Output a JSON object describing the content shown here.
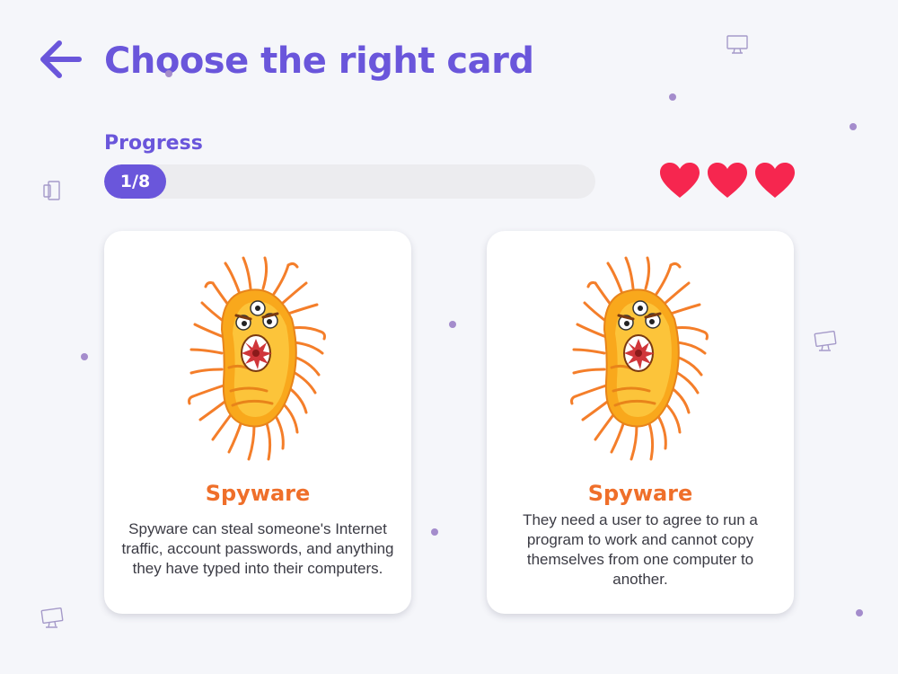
{
  "header": {
    "back_icon": "arrow-left-icon",
    "title": "Choose the right card"
  },
  "progress": {
    "label": "Progress",
    "text": "1/8",
    "current": 1,
    "total": 8
  },
  "lives": {
    "count": 3,
    "icon": "heart-icon",
    "color": "#f6264f"
  },
  "cards": [
    {
      "title": "Spyware",
      "description": "Spyware can steal someone's Internet traffic, account passwords, and anything they have typed into their computers.",
      "image_icon": "bacteria-monster-icon"
    },
    {
      "title": "Spyware",
      "description": "They need a user to agree to run a program to work and cannot copy themselves from one computer to another.",
      "image_icon": "bacteria-monster-icon"
    }
  ],
  "colors": {
    "accent": "#6a56db",
    "card_title": "#ef6f2a",
    "background": "#f5f6fa"
  }
}
